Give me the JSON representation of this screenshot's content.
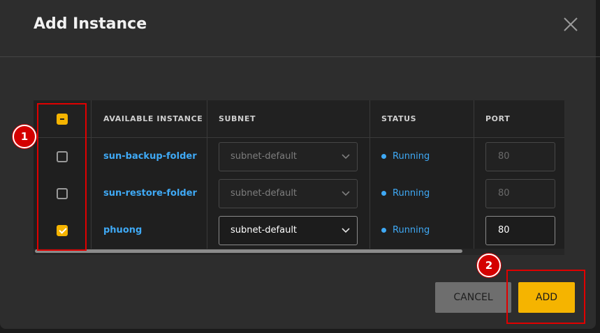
{
  "dialog": {
    "title": "Add Instance"
  },
  "table": {
    "headers": {
      "instance": "AVAILABLE INSTANCE",
      "subnet": "SUBNET",
      "status": "STATUS",
      "port": "PORT"
    },
    "rows": [
      {
        "name": "sun-backup-folder",
        "subnet": "subnet-default",
        "status": "Running",
        "port": "80",
        "checked": false
      },
      {
        "name": "sun-restore-folder",
        "subnet": "subnet-default",
        "status": "Running",
        "port": "80",
        "checked": false
      },
      {
        "name": "phuong",
        "subnet": "subnet-default",
        "status": "Running",
        "port": "80",
        "checked": true
      }
    ]
  },
  "footer": {
    "cancel_label": "CANCEL",
    "add_label": "ADD"
  },
  "annotations": {
    "badge_1": "1",
    "badge_2": "2"
  },
  "colors": {
    "accent": "#f5b400",
    "link": "#3fa9f5",
    "annotation": "#e00000"
  },
  "icons": {
    "close": "close-icon",
    "dropdown": "chevron-down-icon"
  }
}
